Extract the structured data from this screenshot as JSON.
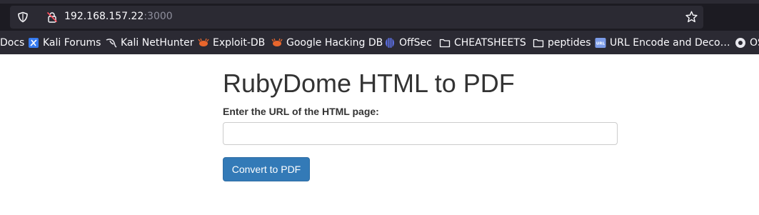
{
  "browser": {
    "url_host": "192.168.157.22",
    "url_port": ":3000",
    "icons": {
      "tracking": "shield-icon",
      "security": "lock-slash-icon",
      "bookmark": "star-icon"
    }
  },
  "bookmarks": [
    {
      "label": "Docs",
      "icon": "none"
    },
    {
      "label": "Kali Forums",
      "icon": "kali-forums-icon"
    },
    {
      "label": "Kali NetHunter",
      "icon": "kali-dragon-icon"
    },
    {
      "label": "Exploit-DB",
      "icon": "exploit-db-icon"
    },
    {
      "label": "Google Hacking DB",
      "icon": "ghdb-icon"
    },
    {
      "label": "OffSec",
      "icon": "offsec-icon"
    },
    {
      "label": "CHEATSHEETS",
      "icon": "folder-icon"
    },
    {
      "label": "peptides",
      "icon": "folder-icon"
    },
    {
      "label": "URL Encode and Deco…",
      "icon": "url-icon"
    },
    {
      "label": "OS",
      "icon": "os-icon"
    }
  ],
  "main": {
    "title": "RubyDome HTML to PDF",
    "url_label": "Enter the URL of the HTML page:",
    "url_value": "",
    "submit_label": "Convert to PDF"
  },
  "colors": {
    "button_primary": "#337ab7",
    "toolbar_bg": "#1c1b22",
    "urlbar_bg": "#2b2a33"
  }
}
